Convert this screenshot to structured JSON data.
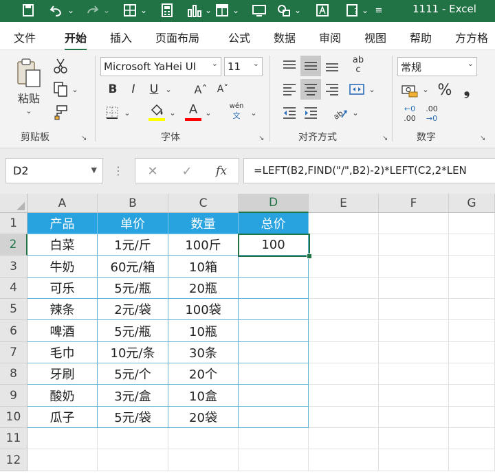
{
  "title_bar": {
    "doc_title": "1111  -  Excel",
    "quick_access": [
      "save-icon",
      "undo-icon",
      "chevron-down-icon",
      "redo-icon",
      "chevron-down-icon",
      "border-icon",
      "chevron-down-icon",
      "calculator-icon",
      "chart-icon",
      "chevron-down-icon",
      "table-icon",
      "chevron-down-icon",
      "screen-icon",
      "shapes-icon",
      "chevron-down-icon",
      "text-box-icon",
      "help-icon",
      "chevron-down-icon",
      "customize-icon"
    ]
  },
  "tabs": [
    "文件",
    "开始",
    "插入",
    "页面布局",
    "公式",
    "数据",
    "审阅",
    "视图",
    "帮助",
    "方方格"
  ],
  "active_tab": "开始",
  "ribbon": {
    "clipboard": {
      "paste": "粘贴",
      "label": "剪贴板"
    },
    "font": {
      "name": "Microsoft YaHei UI",
      "size": "11",
      "bold": "B",
      "italic": "I",
      "underline": "U",
      "grow": "Aˆ",
      "shrink": "Aˇ",
      "font_color_letter": "A",
      "phonetic_top": "wén",
      "phonetic_bottom": "文",
      "label": "字体",
      "fill_color": "#ffff00",
      "font_color": "#ff0000"
    },
    "alignment": {
      "wrap_top": "ab",
      "wrap_bottom": "c",
      "label": "对齐方式"
    },
    "number": {
      "format": "常规",
      "percent": "%",
      "comma": "❟",
      "inc_top": "←0",
      "inc_bottom": ".00",
      "dec_top": ".00",
      "dec_bottom": "→0",
      "label": "数字"
    }
  },
  "formula_bar": {
    "name_box": "D2",
    "cancel": "✕",
    "enter": "✓",
    "fx": "fx",
    "formula": "=LEFT(B2,FIND(\"/\",B2)-2)*LEFT(C2,2*LEN"
  },
  "grid": {
    "columns": [
      "A",
      "B",
      "C",
      "D",
      "E",
      "F",
      "G"
    ],
    "rows": [
      "1",
      "2",
      "3",
      "4",
      "5",
      "6",
      "7",
      "8",
      "9",
      "10",
      "11",
      "12"
    ],
    "selected_column": "D",
    "selected_row": "2",
    "header_fill": "#29a3e0",
    "table": {
      "headers": [
        "产品",
        "单价",
        "数量",
        "总价"
      ],
      "rows": [
        [
          "白菜",
          "1元/斤",
          "100斤",
          "100"
        ],
        [
          "牛奶",
          "60元/箱",
          "10箱",
          ""
        ],
        [
          "可乐",
          "5元/瓶",
          "20瓶",
          ""
        ],
        [
          "辣条",
          "2元/袋",
          "100袋",
          ""
        ],
        [
          "啤酒",
          "5元/瓶",
          "10瓶",
          ""
        ],
        [
          "毛巾",
          "10元/条",
          "30条",
          ""
        ],
        [
          "牙刷",
          "5元/个",
          "20个",
          ""
        ],
        [
          "酸奶",
          "3元/盒",
          "10盒",
          ""
        ],
        [
          "瓜子",
          "5元/袋",
          "20袋",
          ""
        ]
      ]
    }
  }
}
